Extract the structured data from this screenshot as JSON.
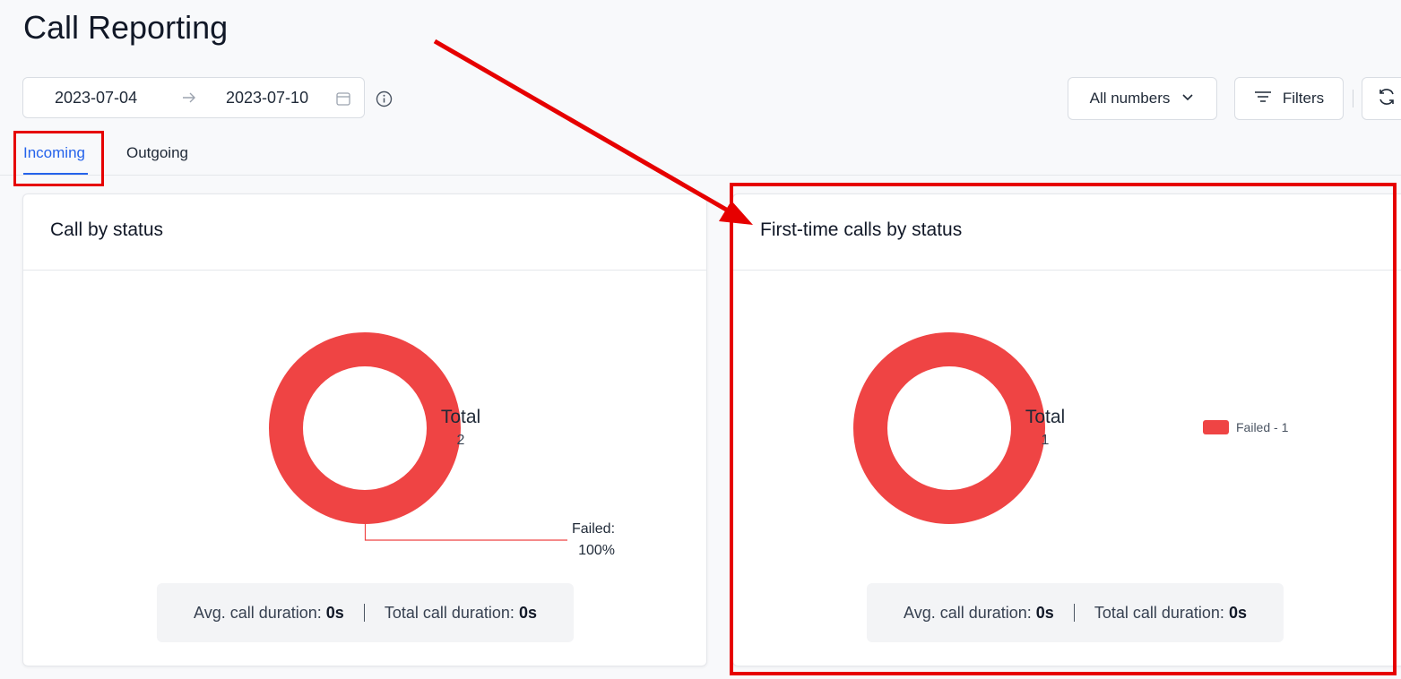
{
  "page": {
    "title": "Call Reporting"
  },
  "date_range": {
    "start": "2023-07-04",
    "end": "2023-07-10"
  },
  "toolbar": {
    "numbers_label": "All numbers",
    "filters_label": "Filters"
  },
  "tabs": [
    {
      "label": "Incoming",
      "active": true
    },
    {
      "label": "Outgoing",
      "active": false
    }
  ],
  "cards": [
    {
      "title": "Call by status",
      "total_label": "Total",
      "total_value": "2",
      "callout": {
        "line1": "Failed:",
        "line2": "100%"
      },
      "summary": {
        "avg_label": "Avg. call duration:",
        "avg_value": "0s",
        "total_label": "Total call duration:",
        "total_value": "0s"
      }
    },
    {
      "title": "First-time calls by status",
      "total_label": "Total",
      "total_value": "1",
      "legend": [
        {
          "label": "Failed - 1",
          "color": "#ef4444"
        }
      ],
      "summary": {
        "avg_label": "Avg. call duration:",
        "avg_value": "0s",
        "total_label": "Total call duration:",
        "total_value": "0s"
      }
    }
  ],
  "colors": {
    "accent": "#2563eb",
    "failed": "#ef4444",
    "annotation": "#e60000"
  },
  "icons": [
    "arrow-right-icon",
    "calendar-icon",
    "info-icon",
    "chevron-down-icon",
    "filter-icon",
    "refresh-icon"
  ]
}
